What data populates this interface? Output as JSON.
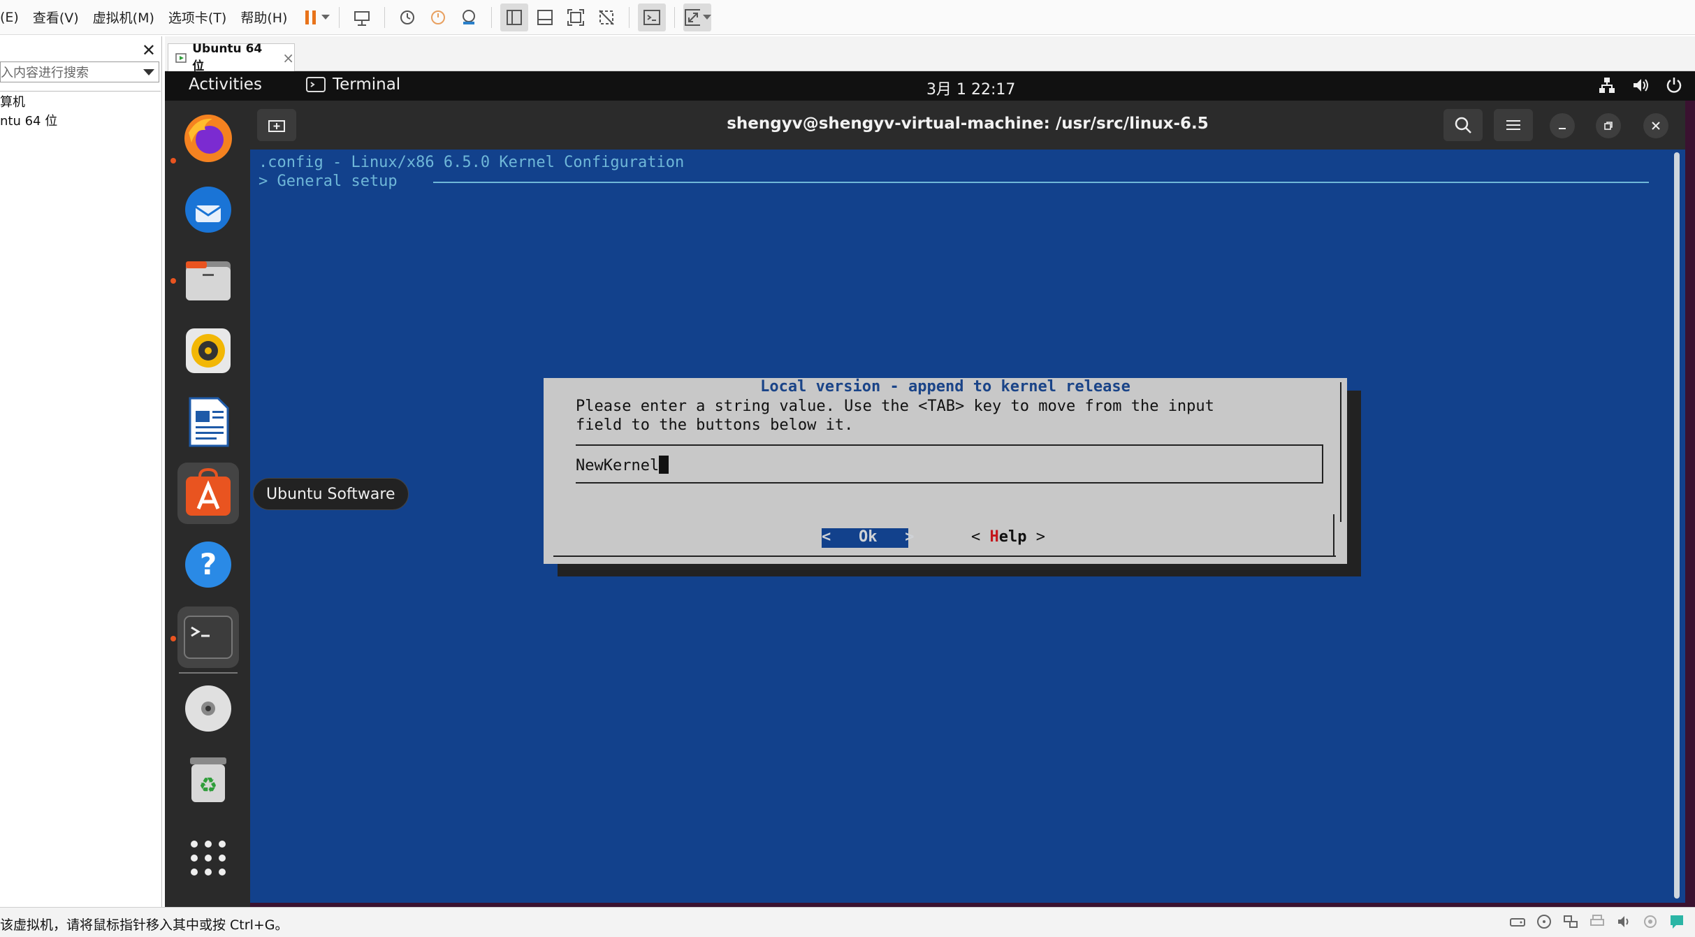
{
  "vmware": {
    "menus": [
      "(E)",
      "查看(V)",
      "虚拟机(M)",
      "选项卡(T)",
      "帮助(H)"
    ],
    "library": {
      "search_placeholder": "入内容进行搜索",
      "tree": [
        "算机",
        "ntu 64 位"
      ]
    },
    "tab_label": "Ubuntu 64 位",
    "status_text": "该虚拟机，请将鼠标指针移入其中或按 Ctrl+G。"
  },
  "ubuntu": {
    "activities": "Activities",
    "app_name": "Terminal",
    "clock": "3月 1  22:17",
    "dock_tooltip": "Ubuntu Software",
    "dock_items": [
      "firefox-icon",
      "thunderbird-icon",
      "files-icon",
      "rhythmbox-icon",
      "libreoffice-writer-icon",
      "ubuntu-software-icon",
      "help-icon",
      "terminal-icon",
      "dvd-icon",
      "trash-icon",
      "show-apps-icon"
    ]
  },
  "terminal": {
    "title": "shengyv@shengyv-virtual-machine: /usr/src/linux-6.5",
    "config_title": ".config - Linux/x86 6.5.0 Kernel Configuration",
    "breadcrumb": "> General setup",
    "dialog": {
      "title": "Local version - append to kernel release",
      "message": "Please enter a string value. Use the <TAB> key to move from the input\nfield to the buttons below it.",
      "input_value": "NewKernel",
      "ok_label": "<   Ok   >",
      "help_left": "< ",
      "help_hotkey": "H",
      "help_rest": "elp",
      "help_right": " >"
    }
  },
  "colors": {
    "terminal_bg": "#12418c",
    "dialog_bg": "#c8c8c8",
    "accent": "#e95420"
  }
}
